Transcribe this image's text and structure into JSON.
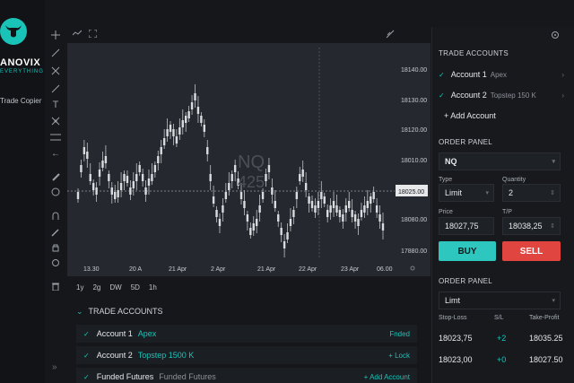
{
  "brand": {
    "name": "ANOVIX",
    "tagline": "EVERYTHING",
    "nav_item": "Trade Copier"
  },
  "chart": {
    "symbol_watermark": "NQ",
    "watermark_sub": "425",
    "price_ticks": [
      "18140.00",
      "18130.00",
      "18120.00",
      "18010.00",
      "18080.00",
      "17880.00"
    ],
    "current_price_label": "18025.00",
    "time_ticks": [
      "13.30",
      "20 A",
      "21 Apr",
      "2 Apr",
      "21 Apr",
      "22 Apr",
      "23 Apr",
      "06.00"
    ],
    "timeframes": [
      "1y",
      "2g",
      "DW",
      "5D",
      "1h"
    ]
  },
  "bottom_accounts": {
    "header": "TRADE ACCOUNTS",
    "rows": [
      {
        "name": "Account 1",
        "tag": "Apex",
        "action": "Fnded"
      },
      {
        "name": "Account 2",
        "tag": "Topstep 1500 K",
        "action": "+ Lock"
      },
      {
        "name": "Funded Futures",
        "tag": "Funded Futures",
        "action": "+ Add Account"
      }
    ]
  },
  "panel": {
    "accounts_header": "TRADE ACCOUNTS",
    "accounts": [
      {
        "name": "Account 1",
        "sub": "Apex"
      },
      {
        "name": "Account 2",
        "sub": "Topstep 150 K"
      }
    ],
    "add_account": "+ Add Account",
    "order_panel_header": "ORDER PANEL",
    "symbol": "NQ",
    "type_label": "Type",
    "type_value": "Limit",
    "quantity_label": "Quantity",
    "quantity_value": "2",
    "price_label": "Price",
    "price_value": "18027,75",
    "tp_label": "T/P",
    "tp_value": "18038,25",
    "buy_label": "BUY",
    "sell_label": "SELL",
    "order_panel_header_2": "ORDER PANEL",
    "limit_select": "Limt",
    "col_stoploss": "Stop-Loss",
    "col_sl": "S/L",
    "col_takeprofit": "Take-Profit",
    "rows": [
      {
        "stop": "18023,75",
        "sl": "+2",
        "take": "18035.25"
      },
      {
        "stop": "18023,00",
        "sl": "+0",
        "take": "18027.50"
      }
    ]
  },
  "colors": {
    "accent": "#19c3b8",
    "sell": "#e0453f",
    "chart_bg": "#25282e",
    "candle": "#d9dcdf"
  }
}
